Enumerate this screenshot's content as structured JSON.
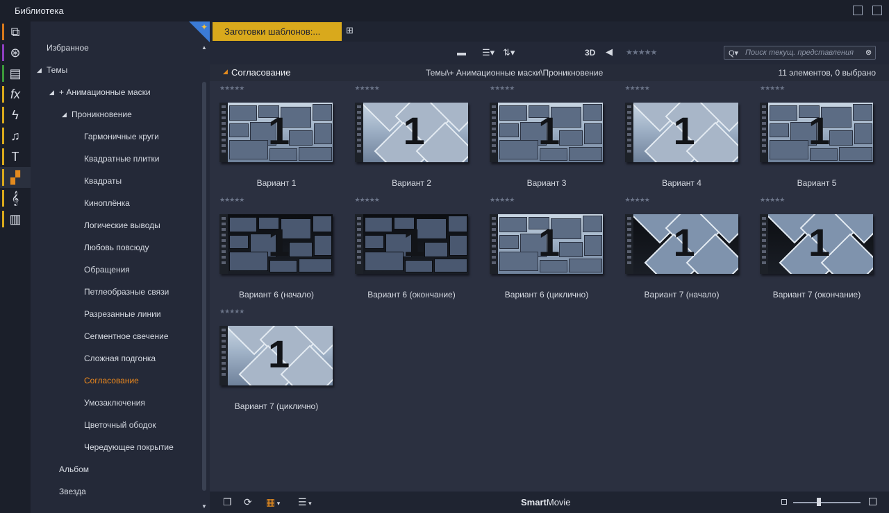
{
  "window": {
    "title": "Библиотека"
  },
  "sidebar_icons": [
    {
      "name": "cube-icon",
      "glyph": "⧉",
      "stripe": "#d6781c"
    },
    {
      "name": "film-reel-icon",
      "glyph": "⊛",
      "stripe": "#8e3fc1"
    },
    {
      "name": "layers-icon",
      "glyph": "▤",
      "stripe": "#3c9a3a"
    },
    {
      "name": "fx-icon",
      "glyph": "fx",
      "stripe": "#d9a91c"
    },
    {
      "name": "lightning-icon",
      "glyph": "ϟ",
      "stripe": "#d9a91c"
    },
    {
      "name": "music-note-icon",
      "glyph": "♫",
      "stripe": "#d9a91c"
    },
    {
      "name": "title-icon",
      "glyph": "T",
      "stripe": "#d9a91c"
    },
    {
      "name": "montage-icon",
      "glyph": "▞",
      "stripe": "#d9a91c"
    },
    {
      "name": "treble-clef-icon",
      "glyph": "𝄞",
      "stripe": "#d9a91c"
    },
    {
      "name": "piano-icon",
      "glyph": "▥",
      "stripe": "#d9a91c"
    }
  ],
  "tree": {
    "favorites": "Избранное",
    "themes": "Темы",
    "anim_masks": "+ Анимационные маски",
    "penetration": "Проникновение",
    "items": [
      "Гармоничные круги",
      "Квадратные плитки",
      "Квадраты",
      "Киноплёнка",
      "Логические выводы",
      "Любовь повсюду",
      "Обращения",
      "Петлеобразные связи",
      "Разрезанные линии",
      "Сегментное свечение",
      "Сложная подгонка",
      "Согласование",
      "Умозаключения",
      "Цветочный ободок",
      "Чередующее покрытие"
    ],
    "selected_index": 11,
    "album": "Альбом",
    "star": "Звезда"
  },
  "tabs": {
    "active_label": "Заготовки шаблонов:..."
  },
  "toolbar": {
    "folder_icon": "folder-icon",
    "list_icon": "list-view-icon",
    "sort_icon": "sort-icon",
    "three_d_label": "3D",
    "tag_icon": "tag-icon",
    "rating_stars": "★★★★★",
    "search_placeholder": "Поиск текущ. представления"
  },
  "pathbar": {
    "current": "Согласование",
    "path": "Темы\\+ Анимационные маски\\Проникновение",
    "count": "11 элементов, 0 выбрано"
  },
  "items": [
    {
      "label": "Вариант 1",
      "style": "blocks"
    },
    {
      "label": "Вариант 2",
      "style": "diamonds"
    },
    {
      "label": "Вариант 3",
      "style": "blocks"
    },
    {
      "label": "Вариант 4",
      "style": "diamonds"
    },
    {
      "label": "Вариант 5",
      "style": "blocks"
    },
    {
      "label": "Вариант 6 (начало)",
      "style": "dark"
    },
    {
      "label": "Вариант 6 (окончание)",
      "style": "dark"
    },
    {
      "label": "Вариант 6 (циклично)",
      "style": "blocks"
    },
    {
      "label": "Вариант 7 (начало)",
      "style": "darkdiamond"
    },
    {
      "label": "Вариант 7 (окончание)",
      "style": "darkdiamond"
    },
    {
      "label": "Вариант 7 (циклично)",
      "style": "diamonds"
    }
  ],
  "item_rating": "★★★★★",
  "thumb_number": "1",
  "bottombar": {
    "brand_bold": "Smart",
    "brand_rest": "Movie",
    "zoom_level": 0.35
  }
}
